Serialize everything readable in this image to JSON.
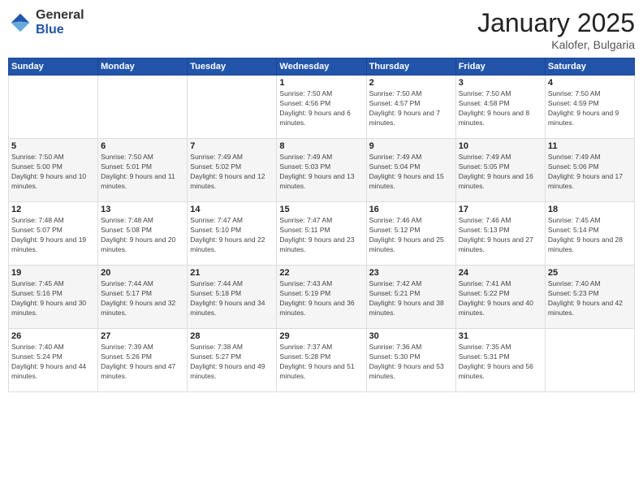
{
  "logo": {
    "general": "General",
    "blue": "Blue"
  },
  "header": {
    "month": "January 2025",
    "location": "Kalofer, Bulgaria"
  },
  "weekdays": [
    "Sunday",
    "Monday",
    "Tuesday",
    "Wednesday",
    "Thursday",
    "Friday",
    "Saturday"
  ],
  "weeks": [
    [
      {
        "day": "",
        "sunrise": "",
        "sunset": "",
        "daylight": ""
      },
      {
        "day": "",
        "sunrise": "",
        "sunset": "",
        "daylight": ""
      },
      {
        "day": "",
        "sunrise": "",
        "sunset": "",
        "daylight": ""
      },
      {
        "day": "1",
        "sunrise": "Sunrise: 7:50 AM",
        "sunset": "Sunset: 4:56 PM",
        "daylight": "Daylight: 9 hours and 6 minutes."
      },
      {
        "day": "2",
        "sunrise": "Sunrise: 7:50 AM",
        "sunset": "Sunset: 4:57 PM",
        "daylight": "Daylight: 9 hours and 7 minutes."
      },
      {
        "day": "3",
        "sunrise": "Sunrise: 7:50 AM",
        "sunset": "Sunset: 4:58 PM",
        "daylight": "Daylight: 9 hours and 8 minutes."
      },
      {
        "day": "4",
        "sunrise": "Sunrise: 7:50 AM",
        "sunset": "Sunset: 4:59 PM",
        "daylight": "Daylight: 9 hours and 9 minutes."
      }
    ],
    [
      {
        "day": "5",
        "sunrise": "Sunrise: 7:50 AM",
        "sunset": "Sunset: 5:00 PM",
        "daylight": "Daylight: 9 hours and 10 minutes."
      },
      {
        "day": "6",
        "sunrise": "Sunrise: 7:50 AM",
        "sunset": "Sunset: 5:01 PM",
        "daylight": "Daylight: 9 hours and 11 minutes."
      },
      {
        "day": "7",
        "sunrise": "Sunrise: 7:49 AM",
        "sunset": "Sunset: 5:02 PM",
        "daylight": "Daylight: 9 hours and 12 minutes."
      },
      {
        "day": "8",
        "sunrise": "Sunrise: 7:49 AM",
        "sunset": "Sunset: 5:03 PM",
        "daylight": "Daylight: 9 hours and 13 minutes."
      },
      {
        "day": "9",
        "sunrise": "Sunrise: 7:49 AM",
        "sunset": "Sunset: 5:04 PM",
        "daylight": "Daylight: 9 hours and 15 minutes."
      },
      {
        "day": "10",
        "sunrise": "Sunrise: 7:49 AM",
        "sunset": "Sunset: 5:05 PM",
        "daylight": "Daylight: 9 hours and 16 minutes."
      },
      {
        "day": "11",
        "sunrise": "Sunrise: 7:49 AM",
        "sunset": "Sunset: 5:06 PM",
        "daylight": "Daylight: 9 hours and 17 minutes."
      }
    ],
    [
      {
        "day": "12",
        "sunrise": "Sunrise: 7:48 AM",
        "sunset": "Sunset: 5:07 PM",
        "daylight": "Daylight: 9 hours and 19 minutes."
      },
      {
        "day": "13",
        "sunrise": "Sunrise: 7:48 AM",
        "sunset": "Sunset: 5:08 PM",
        "daylight": "Daylight: 9 hours and 20 minutes."
      },
      {
        "day": "14",
        "sunrise": "Sunrise: 7:47 AM",
        "sunset": "Sunset: 5:10 PM",
        "daylight": "Daylight: 9 hours and 22 minutes."
      },
      {
        "day": "15",
        "sunrise": "Sunrise: 7:47 AM",
        "sunset": "Sunset: 5:11 PM",
        "daylight": "Daylight: 9 hours and 23 minutes."
      },
      {
        "day": "16",
        "sunrise": "Sunrise: 7:46 AM",
        "sunset": "Sunset: 5:12 PM",
        "daylight": "Daylight: 9 hours and 25 minutes."
      },
      {
        "day": "17",
        "sunrise": "Sunrise: 7:46 AM",
        "sunset": "Sunset: 5:13 PM",
        "daylight": "Daylight: 9 hours and 27 minutes."
      },
      {
        "day": "18",
        "sunrise": "Sunrise: 7:45 AM",
        "sunset": "Sunset: 5:14 PM",
        "daylight": "Daylight: 9 hours and 28 minutes."
      }
    ],
    [
      {
        "day": "19",
        "sunrise": "Sunrise: 7:45 AM",
        "sunset": "Sunset: 5:16 PM",
        "daylight": "Daylight: 9 hours and 30 minutes."
      },
      {
        "day": "20",
        "sunrise": "Sunrise: 7:44 AM",
        "sunset": "Sunset: 5:17 PM",
        "daylight": "Daylight: 9 hours and 32 minutes."
      },
      {
        "day": "21",
        "sunrise": "Sunrise: 7:44 AM",
        "sunset": "Sunset: 5:18 PM",
        "daylight": "Daylight: 9 hours and 34 minutes."
      },
      {
        "day": "22",
        "sunrise": "Sunrise: 7:43 AM",
        "sunset": "Sunset: 5:19 PM",
        "daylight": "Daylight: 9 hours and 36 minutes."
      },
      {
        "day": "23",
        "sunrise": "Sunrise: 7:42 AM",
        "sunset": "Sunset: 5:21 PM",
        "daylight": "Daylight: 9 hours and 38 minutes."
      },
      {
        "day": "24",
        "sunrise": "Sunrise: 7:41 AM",
        "sunset": "Sunset: 5:22 PM",
        "daylight": "Daylight: 9 hours and 40 minutes."
      },
      {
        "day": "25",
        "sunrise": "Sunrise: 7:40 AM",
        "sunset": "Sunset: 5:23 PM",
        "daylight": "Daylight: 9 hours and 42 minutes."
      }
    ],
    [
      {
        "day": "26",
        "sunrise": "Sunrise: 7:40 AM",
        "sunset": "Sunset: 5:24 PM",
        "daylight": "Daylight: 9 hours and 44 minutes."
      },
      {
        "day": "27",
        "sunrise": "Sunrise: 7:39 AM",
        "sunset": "Sunset: 5:26 PM",
        "daylight": "Daylight: 9 hours and 47 minutes."
      },
      {
        "day": "28",
        "sunrise": "Sunrise: 7:38 AM",
        "sunset": "Sunset: 5:27 PM",
        "daylight": "Daylight: 9 hours and 49 minutes."
      },
      {
        "day": "29",
        "sunrise": "Sunrise: 7:37 AM",
        "sunset": "Sunset: 5:28 PM",
        "daylight": "Daylight: 9 hours and 51 minutes."
      },
      {
        "day": "30",
        "sunrise": "Sunrise: 7:36 AM",
        "sunset": "Sunset: 5:30 PM",
        "daylight": "Daylight: 9 hours and 53 minutes."
      },
      {
        "day": "31",
        "sunrise": "Sunrise: 7:35 AM",
        "sunset": "Sunset: 5:31 PM",
        "daylight": "Daylight: 9 hours and 56 minutes."
      },
      {
        "day": "",
        "sunrise": "",
        "sunset": "",
        "daylight": ""
      }
    ]
  ]
}
